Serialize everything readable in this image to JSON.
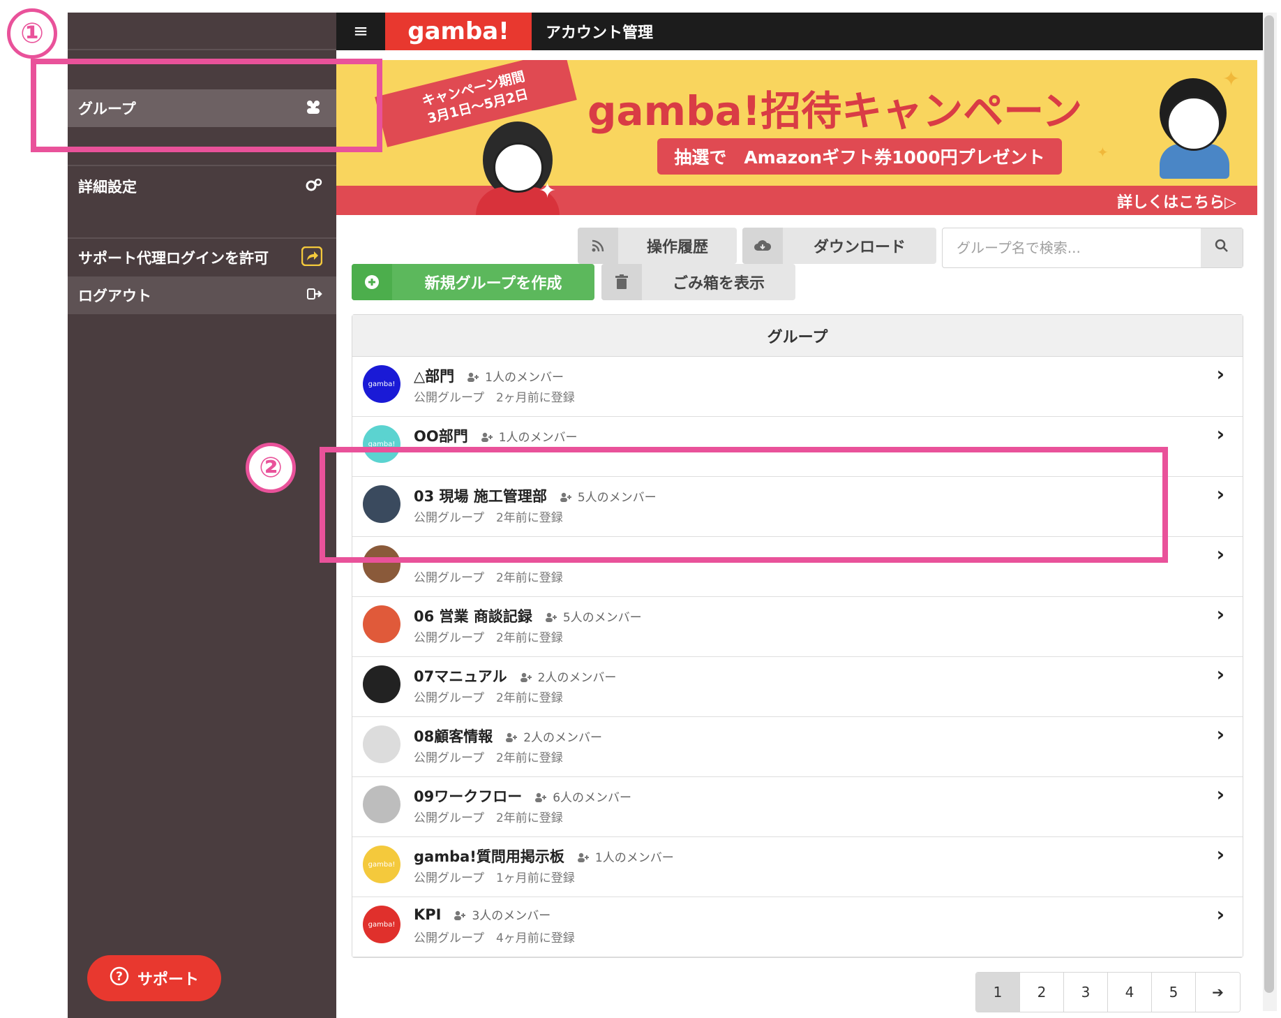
{
  "app": {
    "logo": "gamba!",
    "title": "アカウント管理",
    "menu_icon": "≡"
  },
  "sidebar": {
    "items": [
      {
        "label": "グループ",
        "icon": "group-icon",
        "active": true
      },
      {
        "label": "詳細設定",
        "icon": "gears-icon"
      },
      {
        "label": "サポート代理ログインを許可",
        "icon": "share-icon"
      },
      {
        "label": "ログアウト",
        "icon": "logout-icon"
      }
    ],
    "support_label": "サポート"
  },
  "banner": {
    "ribbon_line1": "キャンペーン期間",
    "ribbon_line2": "3月1日〜5月2日",
    "title": "gamba!招待キャンペーン",
    "prize": "抽選で　Amazonギフト券1000円プレゼント",
    "more": "詳しくはこちら▷"
  },
  "toolbar": {
    "history_label": "操作履歴",
    "download_label": "ダウンロード",
    "search_placeholder": "グループ名で検索...",
    "create_label": "新規グループを作成",
    "trash_label": "ごみ箱を表示"
  },
  "list": {
    "header": "グループ",
    "rows": [
      {
        "name": "△部門",
        "members": "1人のメンバー",
        "meta": "公開グループ　2ヶ月前に登録",
        "avatar_color": "#1a1ad6",
        "avatar_text": "gamba!"
      },
      {
        "name": "OO部門",
        "members": "1人のメンバー",
        "meta": "",
        "avatar_color": "#5bd3d0",
        "avatar_text": "gamba!"
      },
      {
        "name": "03 現場 施工管理部",
        "members": "5人のメンバー",
        "meta": "公開グループ　2年前に登録",
        "avatar_color": "#3a4a5e",
        "avatar_text": ""
      },
      {
        "name": "",
        "members": "",
        "meta": "公開グループ　2年前に登録",
        "avatar_color": "#8a5a3a",
        "avatar_text": ""
      },
      {
        "name": "06 営業 商談記録",
        "members": "5人のメンバー",
        "meta": "公開グループ　2年前に登録",
        "avatar_color": "#e05a3a",
        "avatar_text": ""
      },
      {
        "name": "07マニュアル",
        "members": "2人のメンバー",
        "meta": "公開グループ　2年前に登録",
        "avatar_color": "#222222",
        "avatar_text": ""
      },
      {
        "name": "08顧客情報",
        "members": "2人のメンバー",
        "meta": "公開グループ　2年前に登録",
        "avatar_color": "#dcdcdc",
        "avatar_text": ""
      },
      {
        "name": "09ワークフロー",
        "members": "6人のメンバー",
        "meta": "公開グループ　2年前に登録",
        "avatar_color": "#bdbdbd",
        "avatar_text": ""
      },
      {
        "name": "gamba!質問用掲示板",
        "members": "1人のメンバー",
        "meta": "公開グループ　1ヶ月前に登録",
        "avatar_color": "#f4c93c",
        "avatar_text": "gamba!"
      },
      {
        "name": "KPI",
        "members": "3人のメンバー",
        "meta": "公開グループ　4ヶ月前に登録",
        "avatar_color": "#e0302c",
        "avatar_text": "gamba!"
      }
    ]
  },
  "pagination": {
    "pages": [
      "1",
      "2",
      "3",
      "4",
      "5"
    ],
    "current": "1",
    "next": "➔"
  },
  "annotations": {
    "one": "①",
    "two": "②",
    "color": "#e9529a"
  }
}
